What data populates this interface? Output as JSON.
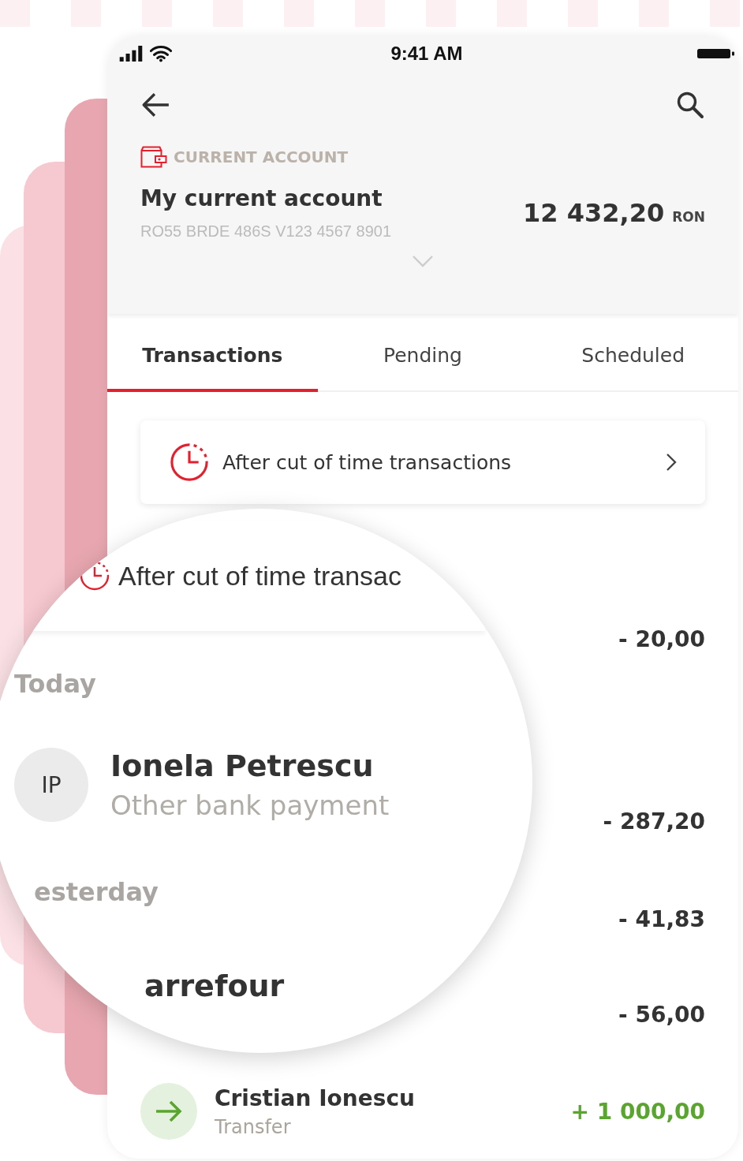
{
  "status_bar": {
    "time": "9:41 AM"
  },
  "account": {
    "label": "CURRENT ACCOUNT",
    "name": "My current account",
    "iban": "RO55 BRDE 486S V123 4567 8901",
    "balance": "12 432,20",
    "currency": "RON"
  },
  "tabs": [
    {
      "label": "Transactions",
      "selected": true
    },
    {
      "label": "Pending",
      "selected": false
    },
    {
      "label": "Scheduled",
      "selected": false
    }
  ],
  "notice": {
    "text": "After cut of time transactions"
  },
  "transactions": [
    {
      "kind": "outgoing",
      "amount": "- 20,00"
    },
    {
      "kind": "outgoing",
      "amount": "- 287,20"
    },
    {
      "kind": "outgoing",
      "amount": "- 41,83"
    },
    {
      "kind": "outgoing",
      "amount": "- 56,00"
    },
    {
      "kind": "incoming",
      "name": "Cristian Ionescu",
      "subtitle": "Transfer",
      "amount": "+ 1 000,00"
    }
  ],
  "magnifier": {
    "notice": "After cut of time transac",
    "sections": [
      {
        "heading": "Today",
        "rows": [
          {
            "initials": "IP",
            "name": "Ionela Petrescu",
            "subtitle": "Other bank payment"
          }
        ]
      },
      {
        "heading": "esterday",
        "rows": [
          {
            "name": "arrefour"
          }
        ]
      }
    ]
  }
}
